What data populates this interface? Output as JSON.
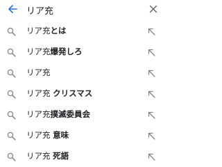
{
  "search": {
    "query": "リア充",
    "back_icon": "arrow-back-icon",
    "clear_icon": "close-icon"
  },
  "colors": {
    "accent": "#1a73e8",
    "icon_gray": "#80868b",
    "text": "#202124"
  },
  "suggestions": [
    {
      "query": "リア充",
      "completion": "とは",
      "spaced": false
    },
    {
      "query": "リア充",
      "completion": "爆発しろ",
      "spaced": false
    },
    {
      "query": "リア充",
      "completion": "",
      "spaced": false
    },
    {
      "query": "リア充",
      "completion": "クリスマス",
      "spaced": true
    },
    {
      "query": "リア充",
      "completion": "撲滅委員会",
      "spaced": false
    },
    {
      "query": "リア充",
      "completion": "意味",
      "spaced": true
    },
    {
      "query": "リア充",
      "completion": "死語",
      "spaced": true
    }
  ],
  "icons": {
    "suggestion": "search-icon",
    "fill": "arrow-up-left-icon"
  }
}
